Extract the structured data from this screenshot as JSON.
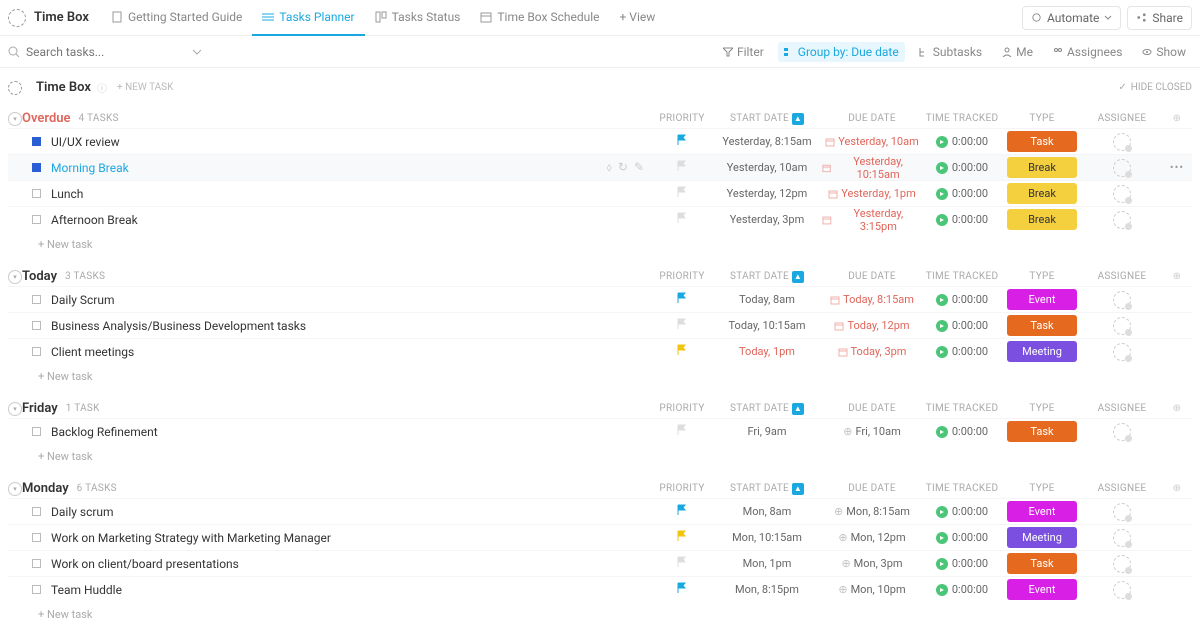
{
  "workspace": "Time Box",
  "tabs": [
    {
      "label": "Getting Started Guide"
    },
    {
      "label": "Tasks Planner"
    },
    {
      "label": "Tasks Status"
    },
    {
      "label": "Time Box Schedule"
    }
  ],
  "addView": "+ View",
  "topbar": {
    "automate": "Automate",
    "share": "Share"
  },
  "search": {
    "placeholder": "Search tasks..."
  },
  "toolbar": {
    "filter": "Filter",
    "groupby": "Group by: Due date",
    "subtasks": "Subtasks",
    "me": "Me",
    "assignees": "Assignees",
    "show": "Show"
  },
  "list": {
    "title": "Time Box",
    "newTask": "+ NEW TASK",
    "hideClosed": "HIDE CLOSED"
  },
  "columns": {
    "priority": "PRIORITY",
    "startDate": "START DATE",
    "dueDate": "DUE DATE",
    "timeTracked": "TIME TRACKED",
    "type": "TYPE",
    "assignee": "ASSIGNEE"
  },
  "addTask": "+ New task",
  "typeColors": {
    "Task": "#e56a1f",
    "Break": "#f4d03f",
    "Event": "#d81fe5",
    "Meeting": "#7b4fe0"
  },
  "sections": [
    {
      "name": "Overdue",
      "count": "4 TASKS",
      "nameColor": "#e0655a",
      "tasks": [
        {
          "name": "UI/UX review",
          "sq": "blue",
          "flag": "#1aa8e0",
          "start": "Yesterday, 8:15am",
          "due": "Yesterday, 10am",
          "dueRed": true,
          "tt": "0:00:00",
          "type": "Task"
        },
        {
          "name": "Morning Break",
          "sq": "blue",
          "hover": true,
          "active": true,
          "icons": true,
          "start": "Yesterday, 10am",
          "due": "Yesterday, 10:15am",
          "dueRed": true,
          "tt": "0:00:00",
          "type": "Break",
          "more": true
        },
        {
          "name": "Lunch",
          "start": "Yesterday, 12pm",
          "due": "Yesterday, 1pm",
          "dueRed": true,
          "tt": "0:00:00",
          "type": "Break"
        },
        {
          "name": "Afternoon Break",
          "start": "Yesterday, 3pm",
          "due": "Yesterday, 3:15pm",
          "dueRed": true,
          "tt": "0:00:00",
          "type": "Break"
        }
      ]
    },
    {
      "name": "Today",
      "count": "3 TASKS",
      "nameColor": "#333",
      "tasks": [
        {
          "name": "Daily Scrum",
          "flag": "#1aa8e0",
          "start": "Today, 8am",
          "due": "Today, 8:15am",
          "dueRed": true,
          "tt": "0:00:00",
          "type": "Event"
        },
        {
          "name": "Business Analysis/Business Development tasks",
          "start": "Today, 10:15am",
          "due": "Today, 12pm",
          "dueRed": true,
          "tt": "0:00:00",
          "type": "Task"
        },
        {
          "name": "Client meetings",
          "flag": "#f1c40f",
          "start": "Today, 1pm",
          "startRed": true,
          "due": "Today, 3pm",
          "dueRed": true,
          "tt": "0:00:00",
          "type": "Meeting"
        }
      ]
    },
    {
      "name": "Friday",
      "count": "1 TASK",
      "nameColor": "#333",
      "tasks": [
        {
          "name": "Backlog Refinement",
          "start": "Fri, 9am",
          "due": "Fri, 10am",
          "tt": "0:00:00",
          "type": "Task"
        }
      ]
    },
    {
      "name": "Monday",
      "count": "6 TASKS",
      "nameColor": "#333",
      "tasks": [
        {
          "name": "Daily scrum",
          "flag": "#1aa8e0",
          "start": "Mon, 8am",
          "due": "Mon, 8:15am",
          "tt": "0:00:00",
          "type": "Event"
        },
        {
          "name": "Work on Marketing Strategy with Marketing Manager",
          "flag": "#f1c40f",
          "start": "Mon, 10:15am",
          "due": "Mon, 12pm",
          "tt": "0:00:00",
          "type": "Meeting"
        },
        {
          "name": "Work on client/board presentations",
          "start": "Mon, 1pm",
          "due": "Mon, 3pm",
          "tt": "0:00:00",
          "type": "Task"
        },
        {
          "name": "Team Huddle",
          "flag": "#1aa8e0",
          "start": "Mon, 8:15pm",
          "due": "Mon, 10pm",
          "tt": "0:00:00",
          "type": "Event"
        }
      ]
    }
  ]
}
